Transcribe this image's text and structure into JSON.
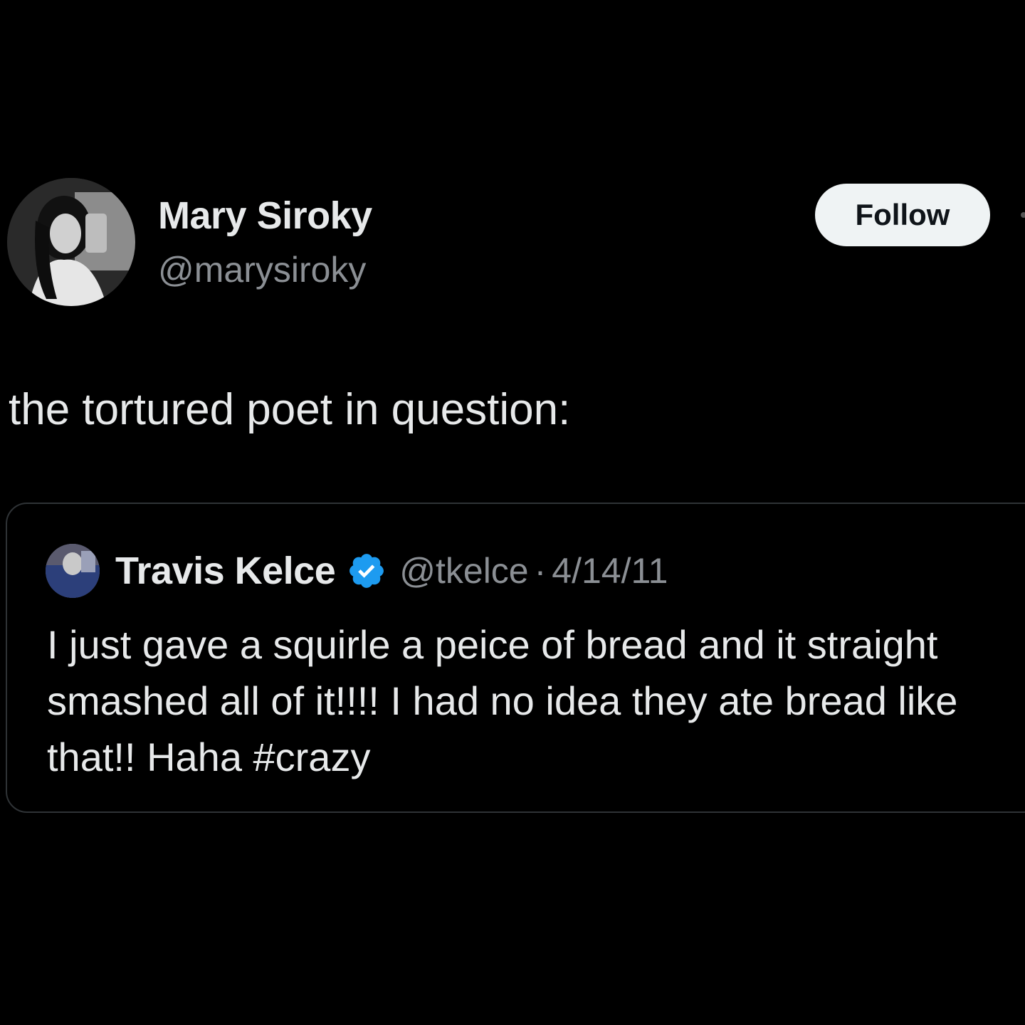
{
  "tweet": {
    "author": {
      "name": "Mary Siroky",
      "handle": "@marysiroky",
      "avatar_icon": "profile-photo"
    },
    "follow_label": "Follow",
    "text": "the tortured poet in question:"
  },
  "quoted_tweet": {
    "author": {
      "name": "Travis Kelce",
      "handle": "@tkelce",
      "verified": true,
      "verified_icon": "verified-badge-icon",
      "avatar_icon": "profile-photo"
    },
    "separator": "·",
    "date": "4/14/11",
    "text": "I just gave a squirle a peice of bread and it straight smashed all of it!!!! I had no idea they ate bread like that!! Haha #crazy"
  },
  "colors": {
    "background": "#000000",
    "text_primary": "#e7e9ea",
    "text_secondary": "#8b8f94",
    "border": "#2f3336",
    "follow_button_bg": "#eff3f4",
    "verified_blue": "#1d9bf0"
  }
}
